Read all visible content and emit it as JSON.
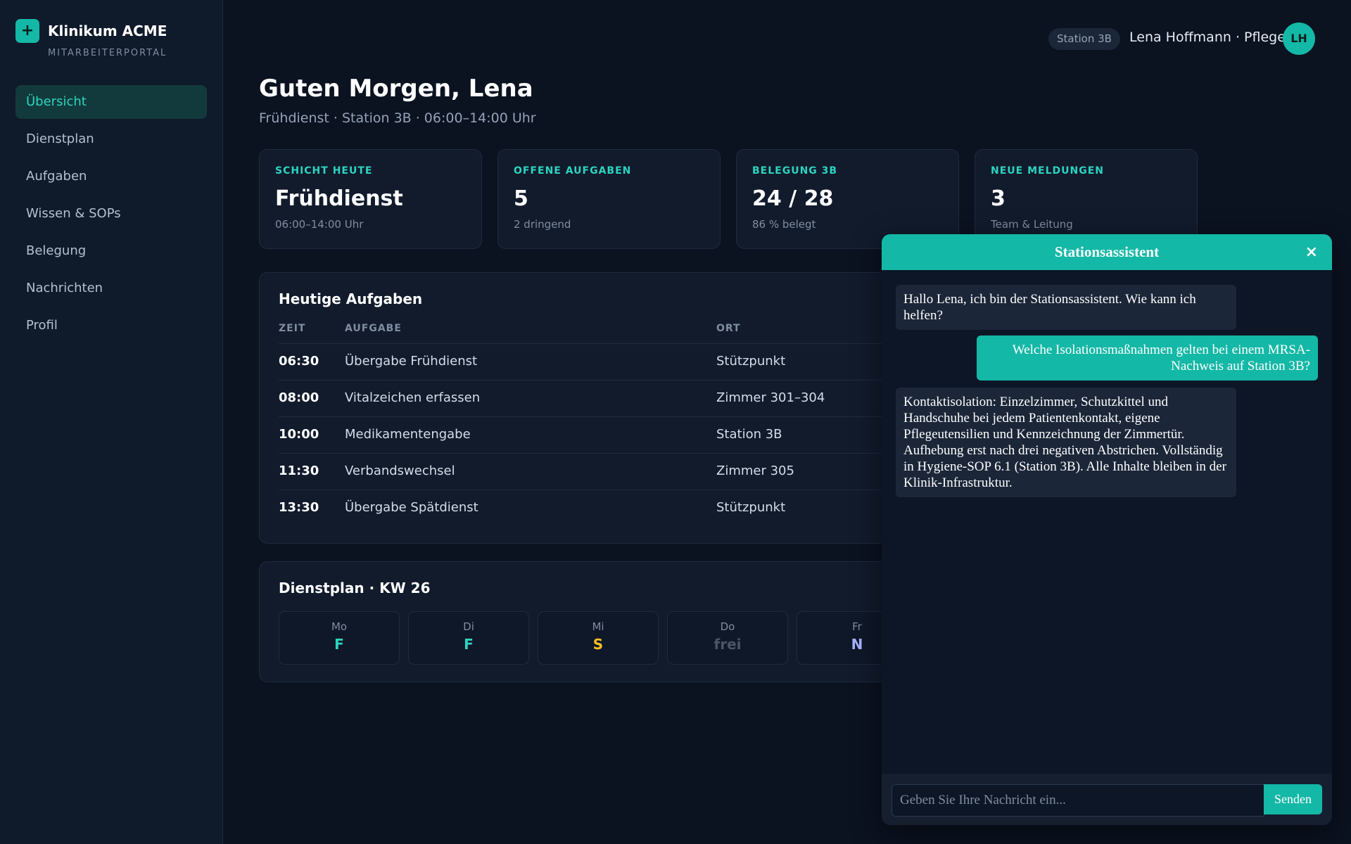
{
  "brand": {
    "logo": "+",
    "name": "Klinikum ACME",
    "subtitle": "MITARBEITERPORTAL"
  },
  "nav": {
    "items": [
      {
        "label": "Übersicht",
        "active": true
      },
      {
        "label": "Dienstplan"
      },
      {
        "label": "Aufgaben"
      },
      {
        "label": "Wissen & SOPs"
      },
      {
        "label": "Belegung"
      },
      {
        "label": "Nachrichten"
      },
      {
        "label": "Profil"
      }
    ]
  },
  "topbar": {
    "station": "Station 3B",
    "user": "Lena Hoffmann · Pflege",
    "initials": "LH"
  },
  "header": {
    "greeting": "Guten Morgen, Lena",
    "subtitle": "Frühdienst · Station 3B · 06:00–14:00 Uhr"
  },
  "stats": [
    {
      "label": "SCHICHT HEUTE",
      "value": "Frühdienst",
      "sub": "06:00–14:00 Uhr"
    },
    {
      "label": "OFFENE AUFGABEN",
      "value": "5",
      "sub": "2 dringend"
    },
    {
      "label": "BELEGUNG 3B",
      "value": "24 / 28",
      "sub": "86 % belegt"
    },
    {
      "label": "NEUE MELDUNGEN",
      "value": "3",
      "sub": "Team & Leitung"
    }
  ],
  "tasks": {
    "title": "Heutige Aufgaben",
    "columns": {
      "time": "ZEIT",
      "task": "AUFGABE",
      "place": "ORT"
    },
    "rows": [
      {
        "time": "06:30",
        "task": "Übergabe Frühdienst",
        "place": "Stützpunkt"
      },
      {
        "time": "08:00",
        "task": "Vitalzeichen erfassen",
        "place": "Zimmer 301–304"
      },
      {
        "time": "10:00",
        "task": "Medikamentengabe",
        "place": "Station 3B"
      },
      {
        "time": "11:30",
        "task": "Verbandswechsel",
        "place": "Zimmer 305"
      },
      {
        "time": "13:30",
        "task": "Übergabe Spätdienst",
        "place": "Stützpunkt"
      }
    ]
  },
  "schedule": {
    "title": "Dienstplan · KW 26",
    "days": [
      {
        "day": "Mo",
        "shift": "F",
        "color": "#2dd4bf"
      },
      {
        "day": "Di",
        "shift": "F",
        "color": "#2dd4bf"
      },
      {
        "day": "Mi",
        "shift": "S",
        "color": "#fbbf24"
      },
      {
        "day": "Do",
        "shift": "frei",
        "color": "#4b5566"
      },
      {
        "day": "Fr",
        "shift": "N",
        "color": "#a5b4fc"
      }
    ]
  },
  "chat": {
    "title": "Stationsassistent",
    "close": "×",
    "messages": [
      {
        "from": "bot",
        "text": "Hallo Lena, ich bin der Stationsassistent. Wie kann ich helfen?"
      },
      {
        "from": "user",
        "text": "Welche Isolationsmaßnahmen gelten bei einem MRSA-Nachweis auf Station 3B?"
      },
      {
        "from": "bot",
        "text": "Kontaktisolation: Einzelzimmer, Schutzkittel und Handschuhe bei jedem Patientenkontakt, eigene Pflegeutensilien und Kennzeichnung der Zimmertür. Aufhebung erst nach drei negativen Abstrichen. Vollständig in Hygiene-SOP 6.1 (Station 3B). Alle Inhalte bleiben in der Klinik-Infrastruktur."
      }
    ],
    "input_placeholder": "Geben Sie Ihre Nachricht ein...",
    "input_value": "",
    "send_label": "Senden"
  },
  "colors": {
    "accent": "#14b8a6",
    "background": "#0b1220",
    "sidebar": "#0f1a2b"
  }
}
